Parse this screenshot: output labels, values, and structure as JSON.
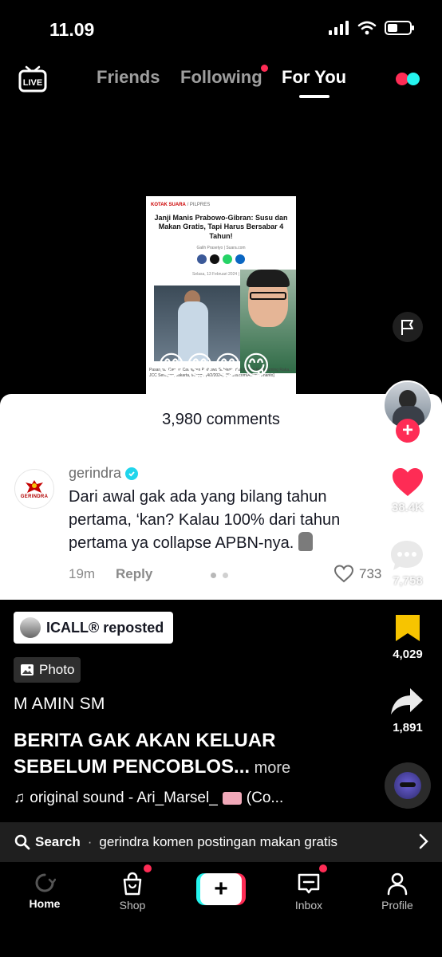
{
  "status": {
    "time": "11.09"
  },
  "top_nav": {
    "tabs": [
      "Friends",
      "Following",
      "For You"
    ],
    "active_tab": "For You",
    "live_label": "LIVE",
    "colors": {
      "accent": "#fe2c55",
      "cyan": "#25f4ee"
    }
  },
  "post_image": {
    "kicker": "KOTAK SUARA",
    "kicker_section": "/ PILPRES",
    "headline": "Janji Manis Prabowo-Gibran: Susu dan Makan Gratis, Tapi Harus Bersabar 4 Tahun!",
    "author_line": "Galih Prasetyo | Suara.com",
    "date_line": "Selasa, 13 Februari 2024 | 18:58",
    "photo_caption": "Pasangan Capres-Cawapres Prabowo Subianto dan Gibran Rakabuming Raka... JCC Senayan, Jakarta, Minggu (4/2/2024). [Suara.com/Alfian Winanto]",
    "emojis": "😋😋😋😋"
  },
  "comments": {
    "title": "3,980 comments",
    "item": {
      "username": "gerindra",
      "avatar_brand": "GERINDRA",
      "text": "Dari awal gak ada yang bilang tahun pertama, ‘kan? Kalau 100% dari tahun pertama ya collapse APBN-nya.",
      "time": "19m",
      "reply_label": "Reply",
      "likes": "733"
    }
  },
  "rail": {
    "likes": "38.4K",
    "comments": "7,758",
    "saves": "4,029",
    "shares": "1,891"
  },
  "post": {
    "repost_label": "ICALL® reposted",
    "photo_label": "Photo",
    "author": "M AMIN SM",
    "caption": "BERITA GAK AKAN KELUAR SEBELUM PENCOBLOS...",
    "more_label": " more",
    "sound": "original sound - Ari_Marsel_",
    "sound_suffix": " (Co..."
  },
  "search": {
    "label": "Search",
    "separator": "·",
    "query": "gerindra komen postingan makan gratis"
  },
  "bottom_nav": {
    "items": [
      "Home",
      "Shop",
      "Inbox",
      "Profile"
    ]
  }
}
